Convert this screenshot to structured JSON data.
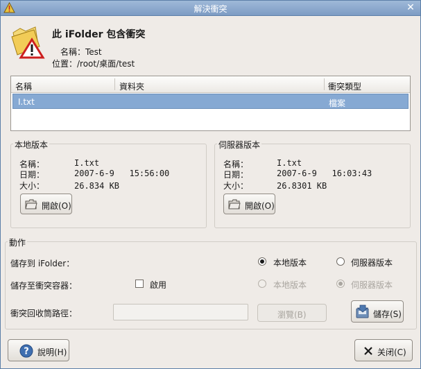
{
  "window": {
    "title": "解決衝突",
    "close_glyph": "✕"
  },
  "header": {
    "title": "此 iFolder 包含衝突",
    "name_line": "名稱：Test",
    "location_line": "位置：/root/桌面/test"
  },
  "conflict_list": {
    "columns": [
      "名稱",
      "資料夾",
      "衝突類型"
    ],
    "rows": [
      {
        "name": "I.txt",
        "folder": "",
        "type": "檔案"
      }
    ]
  },
  "local": {
    "group_label": "本地版本",
    "name_label": "名稱：",
    "name_value": "I.txt",
    "date_label": "日期：",
    "date_value": "2007-6-9   15:56:00",
    "size_label": "大小：",
    "size_value": "26.834 KB",
    "open_label": "開啟(O)"
  },
  "server": {
    "group_label": "伺服器版本",
    "name_label": "名稱：",
    "name_value": "I.txt",
    "date_label": "日期：",
    "date_value": "2007-6-9   16:03:43",
    "size_label": "大小：",
    "size_value": "26.8301 KB",
    "open_label": "開啟(O)"
  },
  "action": {
    "group_label": "動作",
    "save_to_ifolder_label": "儲存到 iFolder：",
    "save_to_conflict_label": "儲存至衝突容器：",
    "enable_label": "啟用",
    "radio_local": "本地版本",
    "radio_server": "伺服器版本",
    "recycle_path_label": "衝突回收筒路徑：",
    "recycle_path_value": "",
    "browse_label": "瀏覽(B)",
    "save_label": "儲存(S)",
    "selected_ifolder_option": "本地版本",
    "selected_conflict_option": "伺服器版本",
    "enable_checked": false
  },
  "footer": {
    "help_label": "說明(H)",
    "close_label": "关闭(C)"
  },
  "colors": {
    "titlebar": "#8aa8cf",
    "selection": "#86a9d3",
    "warning": "#cc1f1f",
    "folder": "#f2cc57"
  }
}
